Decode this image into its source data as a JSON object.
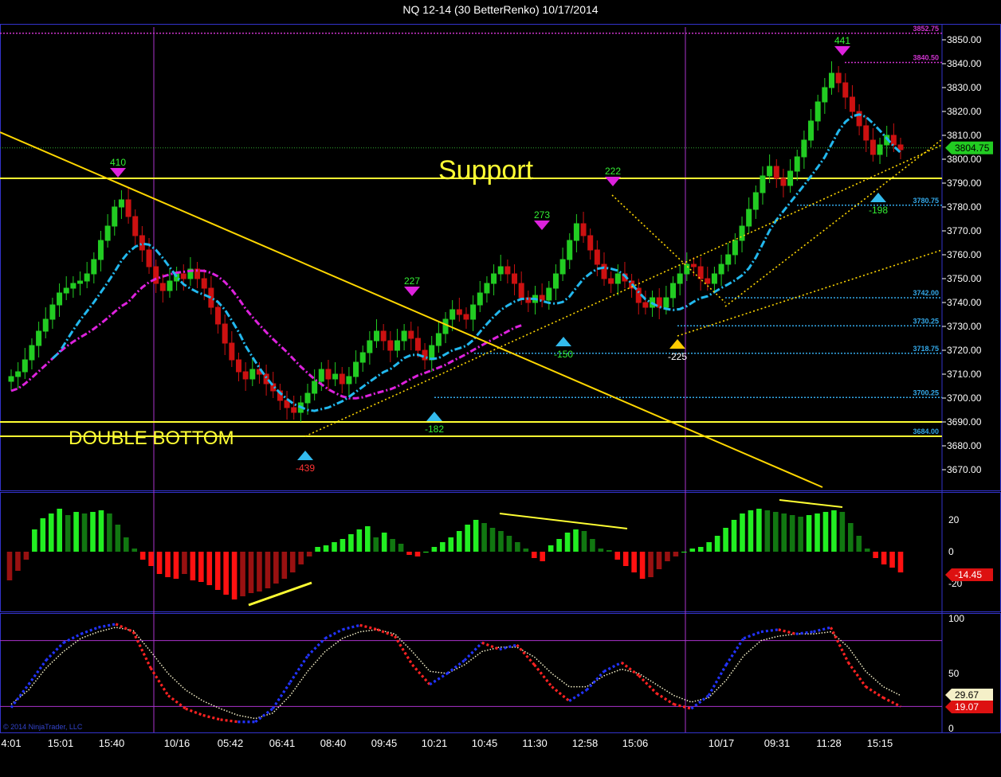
{
  "title": "NQ 12-14 (30 BetterRenko)  10/17/2014",
  "copyright": "© 2014 NinjaTrader, LLC",
  "colors": {
    "background": "#000000",
    "grid_border": "#3333cc",
    "up_bar": "#22cc22",
    "down_bar": "#cc1111",
    "cyan_ma": "#22b8ee",
    "magenta_ma": "#dd22dd",
    "trendline": "#ffd700",
    "support": "#ffff33",
    "level_cyan": "#33a8e8",
    "level_magenta": "#cc33cc",
    "stoch_blue": "#2233ff",
    "stoch_red": "#ff2222",
    "stoch_signal": "#f5f0c8"
  },
  "chart_data": [
    {
      "type": "candlestick",
      "panel": "price",
      "ylim": [
        3664,
        3656
      ],
      "y_ticks": [
        3670,
        3680,
        3690,
        3700,
        3710,
        3720,
        3730,
        3740,
        3750,
        3760,
        3770,
        3780,
        3790,
        3800,
        3810,
        3820,
        3830,
        3840,
        3850
      ],
      "y_tick_labels": [
        "3670.00",
        "3680.00",
        "3690.00",
        "3700.00",
        "3710.00",
        "3720.00",
        "3730.00",
        "3740.00",
        "3750.00",
        "3760.00",
        "3770.00",
        "3780.00",
        "3790.00",
        "3800.00",
        "3810.00",
        "3820.00",
        "3830.00",
        "3840.00",
        "3850.00"
      ],
      "x_tick_labels": [
        "4:01",
        "15:01",
        "15:40",
        "10/16",
        "05:42",
        "06:41",
        "08:40",
        "09:45",
        "10:21",
        "10:45",
        "11:30",
        "12:58",
        "15:06",
        "10/17",
        "09:31",
        "11:28",
        "15:15"
      ],
      "current_price": "3804.75",
      "levels": [
        {
          "price": 3852.75,
          "label": "3852.75",
          "color": "magenta"
        },
        {
          "price": 3840.5,
          "label": "3840.50",
          "color": "magenta"
        },
        {
          "price": 3780.75,
          "label": "3780.75",
          "color": "cyan"
        },
        {
          "price": 3742.0,
          "label": "3742.00",
          "color": "cyan"
        },
        {
          "price": 3730.25,
          "label": "3730.25",
          "color": "cyan"
        },
        {
          "price": 3718.75,
          "label": "3718.75",
          "color": "cyan"
        },
        {
          "price": 3700.25,
          "label": "3700.25",
          "color": "cyan"
        },
        {
          "price": 3684.0,
          "label": "3684.00",
          "color": "cyan"
        }
      ],
      "horizontal_lines": [
        3792,
        3690,
        3684
      ],
      "annotations": [
        "Support",
        "DOUBLE BOTTOM"
      ],
      "swing_labels": [
        {
          "label": "410",
          "kind": "high"
        },
        {
          "label": "227",
          "kind": "high"
        },
        {
          "label": "273",
          "kind": "high"
        },
        {
          "label": "222",
          "kind": "high"
        },
        {
          "label": "441",
          "kind": "high"
        },
        {
          "label": "-439",
          "kind": "low"
        },
        {
          "label": "-182",
          "kind": "low"
        },
        {
          "label": "-150",
          "kind": "low"
        },
        {
          "label": "-225",
          "kind": "low"
        },
        {
          "label": "-198",
          "kind": "low"
        }
      ],
      "closes": [
        3709,
        3711,
        3716,
        3722,
        3728,
        3733,
        3739,
        3744,
        3746,
        3748,
        3749,
        3752,
        3758,
        3766,
        3772,
        3780,
        3783,
        3776,
        3768,
        3762,
        3755,
        3748,
        3745,
        3749,
        3752,
        3750,
        3754,
        3750,
        3746,
        3738,
        3731,
        3723,
        3716,
        3711,
        3708,
        3712,
        3710,
        3706,
        3703,
        3699,
        3696,
        3694,
        3698,
        3702,
        3707,
        3712,
        3708,
        3710,
        3706,
        3709,
        3715,
        3719,
        3724,
        3728,
        3724,
        3720,
        3724,
        3728,
        3725,
        3720,
        3716,
        3722,
        3727,
        3733,
        3737,
        3735,
        3733,
        3739,
        3744,
        3748,
        3752,
        3755,
        3752,
        3748,
        3742,
        3740,
        3743,
        3741,
        3746,
        3752,
        3758,
        3766,
        3773,
        3768,
        3762,
        3756,
        3750,
        3748,
        3752,
        3749,
        3746,
        3740,
        3738,
        3742,
        3738,
        3742,
        3748,
        3752,
        3756,
        3755,
        3750,
        3748,
        3752,
        3756,
        3760,
        3766,
        3772,
        3779,
        3786,
        3793,
        3797,
        3792,
        3789,
        3795,
        3801,
        3808,
        3816,
        3824,
        3830,
        3836,
        3832,
        3826,
        3820,
        3814,
        3808,
        3802,
        3806,
        3810,
        3806,
        3804
      ]
    },
    {
      "type": "histogram",
      "panel": "momentum",
      "y_ticks": [
        20,
        0,
        -20
      ],
      "y_tick_labels": [
        "20",
        "0",
        "-20"
      ],
      "current_value": "-14.45",
      "values": [
        -18,
        -12,
        -5,
        14,
        21,
        24,
        27,
        23,
        25,
        24,
        25,
        26,
        24,
        17,
        9,
        2,
        -5,
        -9,
        -14,
        -16,
        -17,
        -14,
        -18,
        -19,
        -21,
        -24,
        -27,
        -30,
        -28,
        -26,
        -25,
        -23,
        -20,
        -17,
        -13,
        -8,
        -3,
        3,
        4,
        6,
        8,
        11,
        14,
        16,
        9,
        12,
        8,
        5,
        -2,
        -3,
        0,
        3,
        6,
        9,
        13,
        17,
        20,
        18,
        15,
        13,
        10,
        6,
        2,
        -4,
        -6,
        4,
        8,
        12,
        14,
        13,
        8,
        2,
        1,
        -5,
        -9,
        -13,
        -17,
        -16,
        -11,
        -6,
        -3,
        0,
        2,
        3,
        6,
        10,
        15,
        20,
        24,
        26,
        27,
        26,
        25,
        24,
        23,
        22,
        23,
        24,
        25,
        26,
        25,
        18,
        10,
        2,
        -4,
        -8,
        -10,
        -13
      ]
    },
    {
      "type": "line",
      "panel": "stochastic",
      "ylim": [
        0,
        100
      ],
      "y_ticks": [
        100,
        50,
        0
      ],
      "y_tick_labels": [
        "100",
        "50",
        "0"
      ],
      "bands": [
        80,
        20
      ],
      "current_values": [
        "29.67",
        "19.07"
      ],
      "series": [
        {
          "values": [
            19,
            40,
            62,
            78,
            86,
            92,
            95,
            88,
            55,
            30,
            18,
            12,
            8,
            6,
            6,
            18,
            42,
            66,
            82,
            90,
            94,
            90,
            84,
            58,
            40,
            50,
            62,
            78,
            72,
            76,
            58,
            38,
            25,
            35,
            52,
            60,
            48,
            32,
            22,
            18,
            30,
            58,
            82,
            88,
            90,
            86,
            88,
            92,
            60,
            38,
            28,
            20
          ]
        },
        {
          "values": [
            22,
            35,
            55,
            70,
            82,
            88,
            92,
            89,
            70,
            50,
            35,
            25,
            18,
            12,
            9,
            14,
            30,
            52,
            70,
            82,
            88,
            90,
            86,
            70,
            52,
            50,
            58,
            70,
            74,
            74,
            65,
            50,
            38,
            38,
            48,
            54,
            50,
            40,
            30,
            24,
            28,
            44,
            66,
            80,
            84,
            86,
            86,
            88,
            74,
            52,
            38,
            30
          ]
        }
      ]
    }
  ]
}
